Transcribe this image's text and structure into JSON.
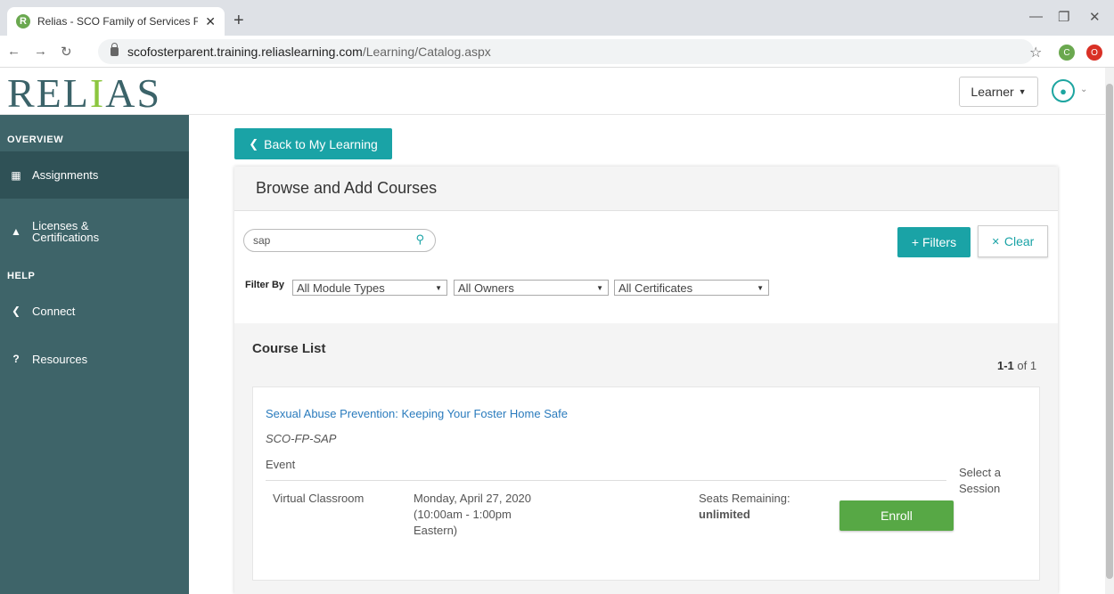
{
  "browser": {
    "tab_title": "Relias - SCO Family of Services Fo",
    "tab_favicon": "R",
    "new_tab": "+",
    "close_tab": "✕",
    "url_host": "scofosterparent.training.reliaslearning.com",
    "url_path": "/Learning/Catalog.aspx",
    "ext_c": "C",
    "ext_o": "O",
    "icons": [
      "back-arrow-icon",
      "forward-arrow-icon",
      "reload-icon",
      "lock-icon",
      "star-icon"
    ]
  },
  "header": {
    "logo_pre": "REL",
    "logo_a": "I",
    "logo_post": "AS",
    "role_label": "Learner"
  },
  "sidebar": {
    "overview_heading": "OVERVIEW",
    "help_heading": "HELP",
    "items": [
      {
        "label": "Assignments",
        "icon": "assignments-icon"
      },
      {
        "label": "Licenses & Certifications",
        "icon": "graduation-cap-icon"
      },
      {
        "label": "Connect",
        "icon": "share-icon"
      },
      {
        "label": "Resources",
        "icon": "question-icon"
      }
    ]
  },
  "main": {
    "back_label": "Back to My Learning",
    "panel_title": "Browse and Add Courses",
    "search_value": "sap",
    "filters_label": "+ Filters",
    "clear_label": "Clear",
    "filter_by_label": "Filter By",
    "filter_module": "All Module Types",
    "filter_owner": "All Owners",
    "filter_cert": "All Certificates",
    "course_list_title": "Course List",
    "pager_range": "1-1",
    "pager_of": "of 1",
    "course": {
      "title": "Sexual Abuse Prevention: Keeping Your Foster Home Safe",
      "code": "SCO-FP-SAP",
      "type": "Event",
      "select_session": "Select a Session",
      "session": {
        "location": "Virtual Classroom",
        "date": "Monday, April 27, 2020",
        "time": "(10:00am - 1:00pm",
        "zone": "Eastern)",
        "seats_label": "Seats Remaining:",
        "seats_value": "unlimited",
        "enroll_label": "Enroll"
      }
    }
  },
  "colors": {
    "sidebar_bg": "#3e6469",
    "accent_teal": "#1aa3a6",
    "enroll_green": "#57a845",
    "link_blue": "#2a7bbd"
  }
}
